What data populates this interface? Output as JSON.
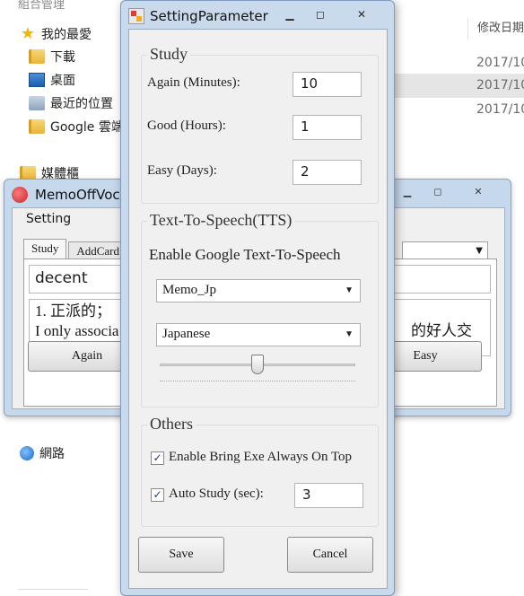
{
  "explorer": {
    "top_cut": "組合管理",
    "favorites": "我的最愛",
    "items": [
      "下載",
      "桌面",
      "最近的位置",
      "Google 雲端硬碟"
    ],
    "media": "媒體櫃",
    "network": "網路",
    "column_header": "修改日期",
    "dates": [
      "2017/10",
      "2017/10",
      "2017/10"
    ]
  },
  "memo": {
    "title": "MemoOffVoc",
    "menu": "Setting",
    "tabs": [
      "Study",
      "AddCard"
    ],
    "word": "decent",
    "definition_line1": "1. 正派的；",
    "definition_line2": "I only associa",
    "definition_right": "的好人交",
    "again_button": "Again",
    "easy_button": "Easy"
  },
  "dialog": {
    "title": "SettingParameter",
    "study": {
      "heading": "Study",
      "again_label": "Again (Minutes):",
      "again_value": "10",
      "good_label": "Good (Hours):",
      "good_value": "1",
      "easy_label": "Easy (Days):",
      "easy_value": "2"
    },
    "tts": {
      "heading": "Text-To-Speech(TTS)",
      "enable_label": "Enable Google Text-To-Speech",
      "voice_selected": "Memo_Jp",
      "language_selected": "Japanese",
      "slider_level": 0.5
    },
    "others": {
      "heading": "Others",
      "always_on_top_label": "Enable Bring Exe Always On Top",
      "always_on_top_checked": true,
      "auto_study_label": "Auto Study (sec):",
      "auto_study_checked": true,
      "auto_study_value": "3"
    },
    "save_button": "Save",
    "cancel_button": "Cancel",
    "checkmark": "✓"
  },
  "colors": {
    "window_frame": "#c9daec",
    "client_bg": "#f0f0f0"
  }
}
